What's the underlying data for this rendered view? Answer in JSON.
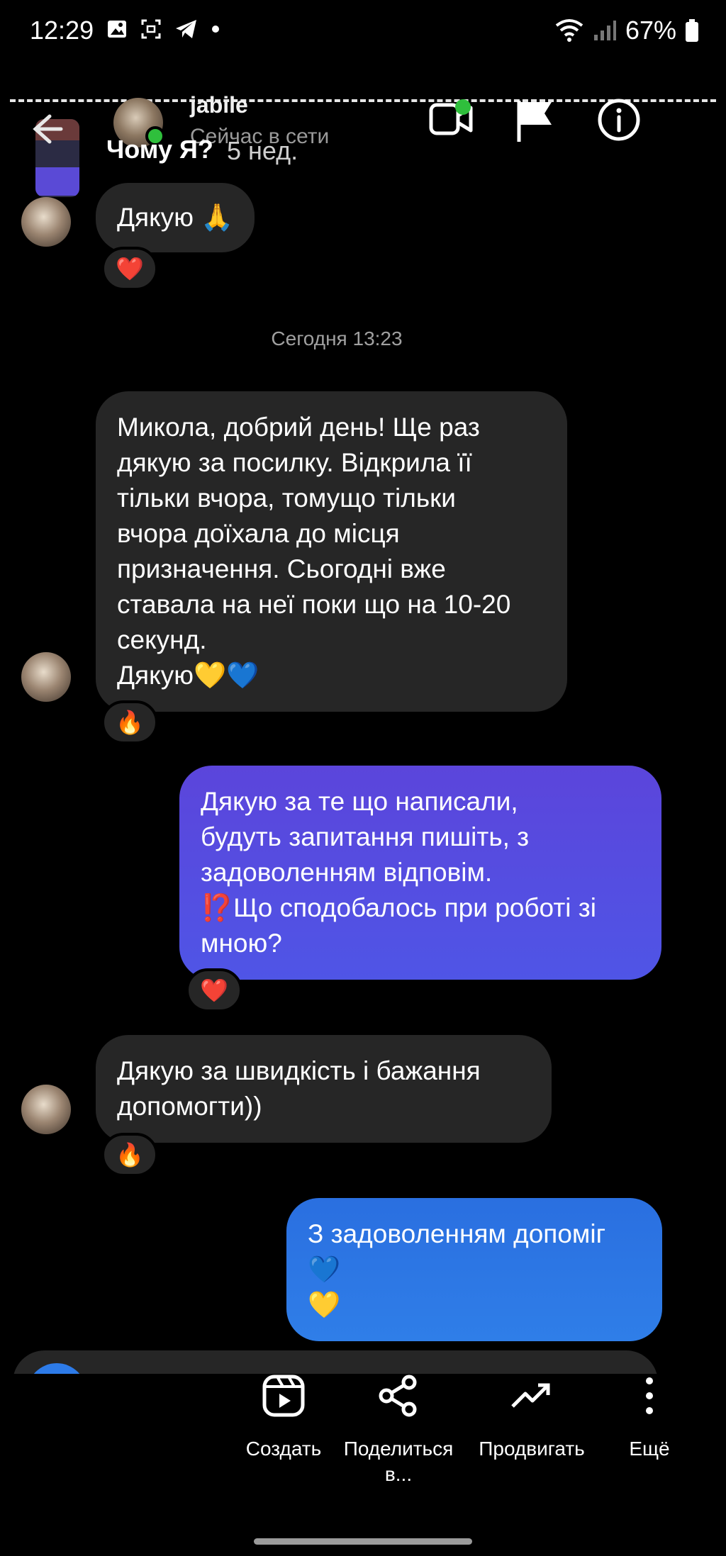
{
  "status_bar": {
    "time": "12:29",
    "battery": "67%"
  },
  "header": {
    "contact_name": "jabile",
    "contact_status": "Сейчас в сети",
    "thread_title": "Чому Я?",
    "thread_age": "5 нед."
  },
  "messages": {
    "m1": {
      "text": "Дякую 🙏",
      "reaction": "❤️"
    },
    "timestamp": "Сегодня 13:23",
    "m2": {
      "lines": [
        "Микола, добрий день! Ще раз",
        "дякую за посилку. Відкрила її",
        "тільки вчора, томущо тільки",
        "вчора доїхала до місця",
        "призначення. Сьогодні вже",
        "ставала на неї поки що на 10-20",
        "секунд.",
        "Дякую💛💙"
      ],
      "reaction": "🔥"
    },
    "m3": {
      "lines": [
        "Дякую за те що написали,",
        "будуть запитання пишіть, з",
        "задоволенням відповім.",
        "⁉️Що сподобалось при роботі зі",
        "мною?"
      ],
      "reaction": "❤️"
    },
    "m4": {
      "lines": [
        "Дякую за швидкість і бажання",
        "допомогти))"
      ],
      "reaction": "🔥"
    },
    "m5": {
      "lines": [
        "З задоволенням допоміг",
        "💙",
        "💛"
      ]
    }
  },
  "actions": {
    "create": "Создать",
    "share_line1": "Поделиться",
    "share_line2": "в...",
    "promote": "Продвигать",
    "more": "Ещё"
  },
  "icons": {
    "back": "arrow-left-icon",
    "video": "video-camera-icon",
    "flag": "flag-icon",
    "info": "info-icon",
    "create": "reels-icon",
    "share": "share-icon",
    "promote": "trending-up-icon",
    "more": "more-vertical-icon"
  },
  "colors": {
    "background": "#000000",
    "incoming_bubble": "#262626",
    "outgoing_purple": "#5a49e0",
    "outgoing_blue": "#2a6fe0",
    "online": "#2fbf3c"
  }
}
